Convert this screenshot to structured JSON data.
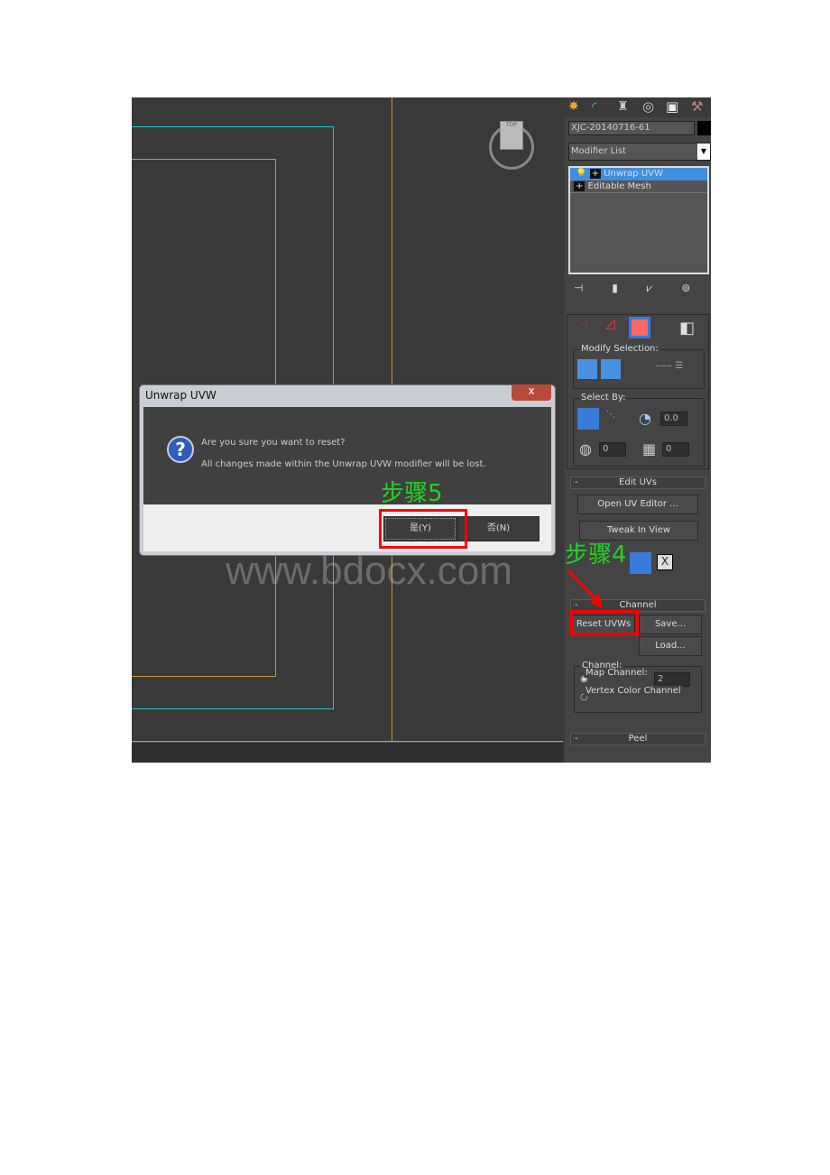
{
  "viewport": {
    "viewcube_label": "TOP"
  },
  "panel": {
    "tabs": [
      "create-icon",
      "modify-icon",
      "hierarchy-icon",
      "motion-icon",
      "display-icon",
      "utilities-icon"
    ],
    "object_name": "XJC-20140716-61",
    "modifier_list": "Modifier List",
    "stack": [
      "Unwrap UVW",
      "Editable Mesh"
    ],
    "modify_selection": "Modify Selection:",
    "select_by": "Select By:",
    "angle_value": "0.0",
    "spin1": "0",
    "spin2": "0",
    "edit_uvs": "Edit UVs",
    "open_uv_editor": "Open UV Editor ...",
    "tweak_in_view": "Tweak In View",
    "channel_header": "Channel",
    "reset_uvws": "Reset UVWs",
    "save": "Save...",
    "load": "Load...",
    "channel_group": "Channel:",
    "map_channel_label": "Map Channel:",
    "map_channel_value": "2",
    "vertex_color_channel": "Vertex Color Channel",
    "peel": "Peel",
    "collapse": "-"
  },
  "dialog": {
    "title": "Unwrap UVW",
    "close": "x",
    "line1": "Are you sure you want to reset?",
    "line2": "All changes made within the  Unwrap UVW modifier will be lost.",
    "yes": "是(Y)",
    "no": "否(N)"
  },
  "annotations": {
    "step5": "步骤5",
    "step4": "步骤4",
    "highlight_color": "#ff0000",
    "step_color": "#21d321"
  },
  "watermark": "www.bdocx.com"
}
